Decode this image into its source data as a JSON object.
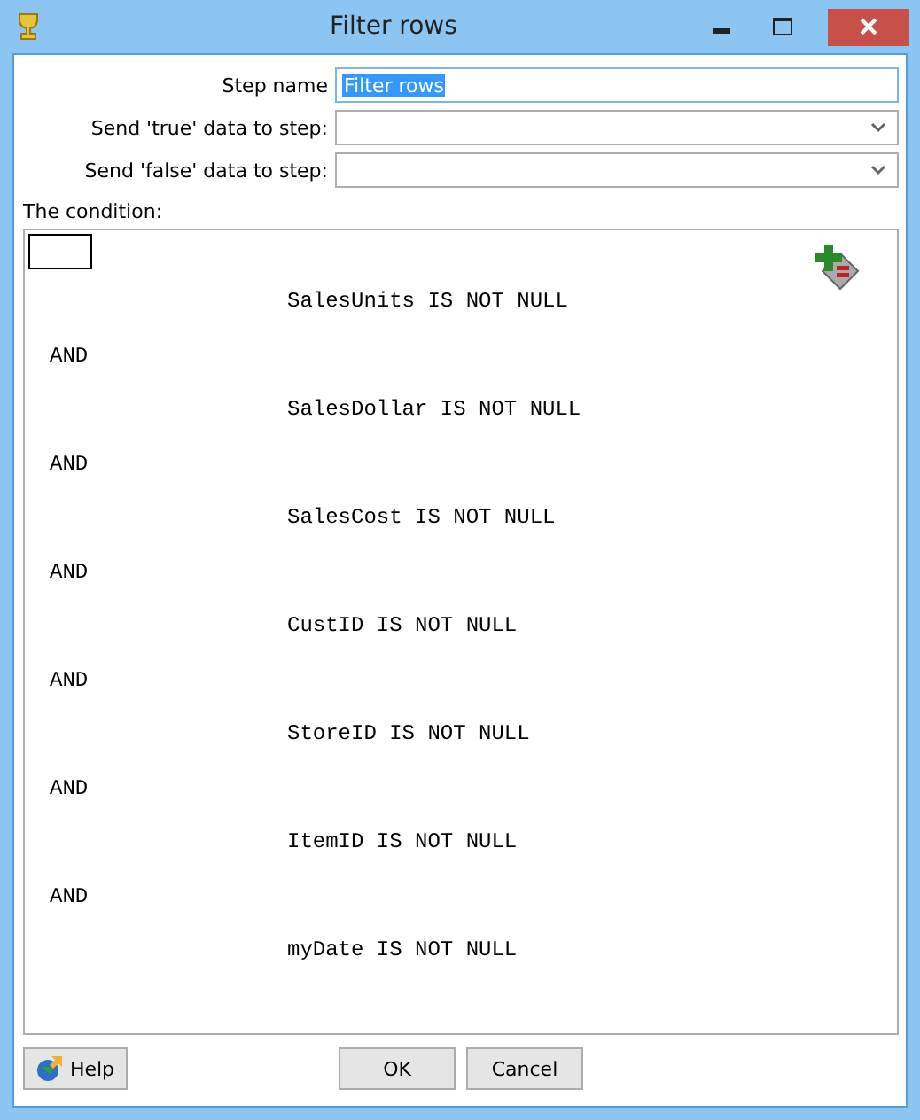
{
  "window": {
    "title": "Filter rows"
  },
  "form": [
    {
      "kind": "text",
      "label": "Step name",
      "value": "Filter rows",
      "selected": true
    },
    {
      "kind": "combo",
      "label": "Send 'true' data to step:"
    },
    {
      "kind": "combo",
      "label": "Send 'false' data to step:"
    }
  ],
  "condition": {
    "label": "The condition:",
    "lines": [
      {
        "kind": "condition",
        "text": "SalesUnits IS NOT NULL"
      },
      {
        "kind": "operator",
        "text": "AND"
      },
      {
        "kind": "condition",
        "text": "SalesDollar IS NOT NULL"
      },
      {
        "kind": "operator",
        "text": "AND"
      },
      {
        "kind": "condition",
        "text": "SalesCost IS NOT NULL"
      },
      {
        "kind": "operator",
        "text": "AND"
      },
      {
        "kind": "condition",
        "text": "CustID IS NOT NULL"
      },
      {
        "kind": "operator",
        "text": "AND"
      },
      {
        "kind": "condition",
        "text": "StoreID IS NOT NULL"
      },
      {
        "kind": "operator",
        "text": "AND"
      },
      {
        "kind": "condition",
        "text": "ItemID IS NOT NULL"
      },
      {
        "kind": "operator",
        "text": "AND"
      },
      {
        "kind": "condition",
        "text": "myDate IS NOT NULL"
      }
    ]
  },
  "buttons": [
    {
      "kind": "help",
      "label": "Help"
    },
    {
      "kind": "ok",
      "label": "OK"
    },
    {
      "kind": "cancel",
      "label": "Cancel"
    }
  ]
}
